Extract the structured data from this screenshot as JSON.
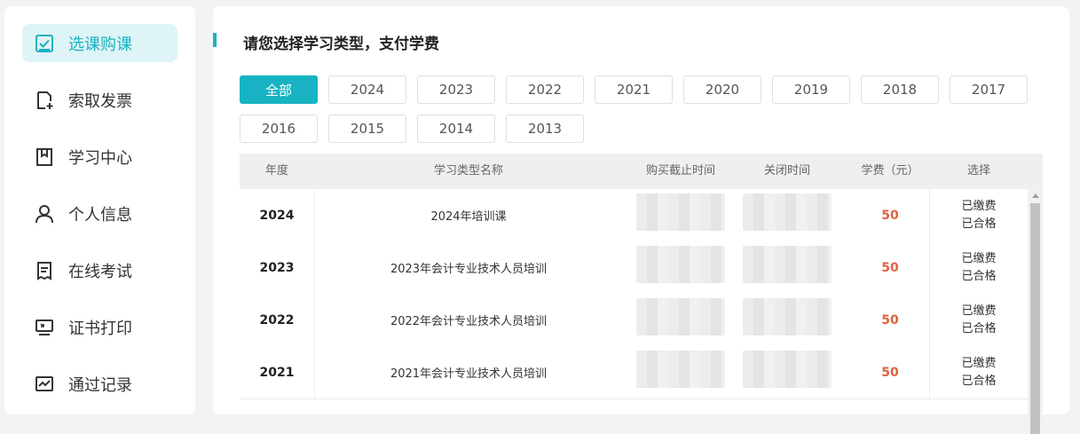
{
  "sidebar": {
    "items": [
      {
        "label": "选课购课",
        "icon": "checkbox-icon",
        "active": true
      },
      {
        "label": "索取发票",
        "icon": "invoice-add-icon"
      },
      {
        "label": "学习中心",
        "icon": "bookmark-icon"
      },
      {
        "label": "个人信息",
        "icon": "user-icon"
      },
      {
        "label": "在线考试",
        "icon": "exam-doc-icon"
      },
      {
        "label": "证书打印",
        "icon": "monitor-print-icon"
      },
      {
        "label": "通过记录",
        "icon": "chart-icon"
      }
    ]
  },
  "main": {
    "title": "请您选择学习类型，支付学费",
    "years": [
      "全部",
      "2024",
      "2023",
      "2022",
      "2021",
      "2020",
      "2019",
      "2018",
      "2017",
      "2016",
      "2015",
      "2014",
      "2013"
    ],
    "table": {
      "headers": [
        "年度",
        "学习类型名称",
        "购买截止时间",
        "关闭时间",
        "学费（元）",
        "选择"
      ],
      "rows": [
        {
          "year": "2024",
          "name": "2024年培训课",
          "fee": "50",
          "paid": "已缴费",
          "passed": "已合格"
        },
        {
          "year": "2023",
          "name": "2023年会计专业技术人员培训",
          "fee": "50",
          "paid": "已缴费",
          "passed": "已合格"
        },
        {
          "year": "2022",
          "name": "2022年会计专业技术人员培训",
          "fee": "50",
          "paid": "已缴费",
          "passed": "已合格"
        },
        {
          "year": "2021",
          "name": "2021年会计专业技术人员培训",
          "fee": "50",
          "paid": "已缴费",
          "passed": "已合格"
        }
      ]
    }
  },
  "colors": {
    "accent": "#17b3c2",
    "fee": "#e0623d",
    "active_bg": "#dff4f6"
  }
}
